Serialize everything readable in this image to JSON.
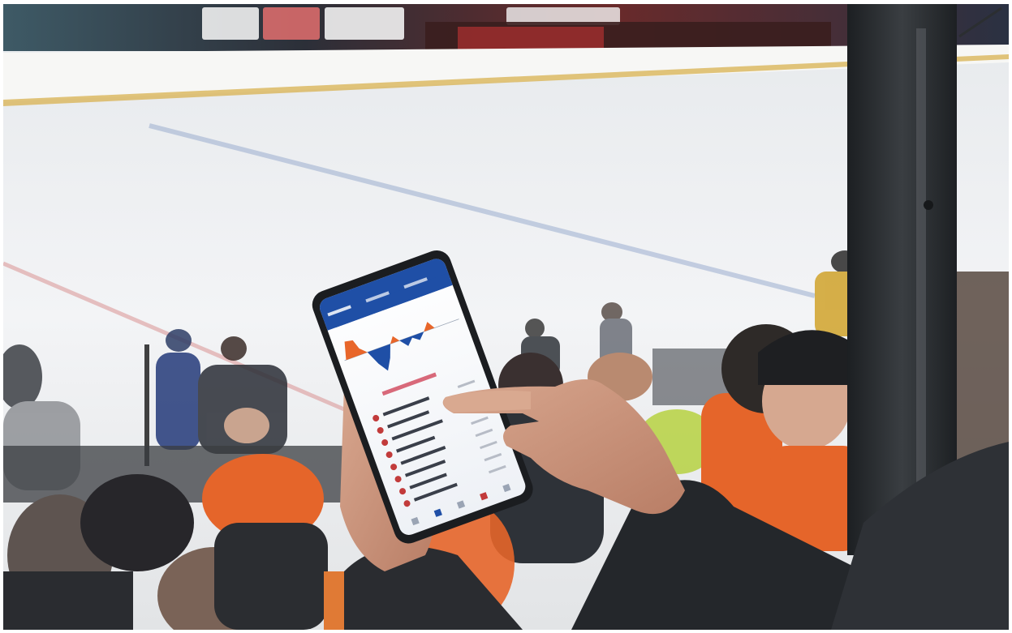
{
  "scene": {
    "description_type": "photo",
    "phone_app": {
      "header_tabs": [
        "",
        "",
        ""
      ],
      "section_title": "",
      "player_list": [
        "",
        "",
        "",
        "",
        "",
        "",
        "",
        "",
        ""
      ],
      "chart_colors": {
        "home": "#e8662a",
        "away": "#1f4fa6"
      },
      "header_color": "#1f4fa6"
    },
    "colors": {
      "ice": "#f1f3f5",
      "boards": "#f7f7f5",
      "post": "#26292c",
      "fan_orange": "#e5652a",
      "jacket": "#24272b"
    }
  }
}
